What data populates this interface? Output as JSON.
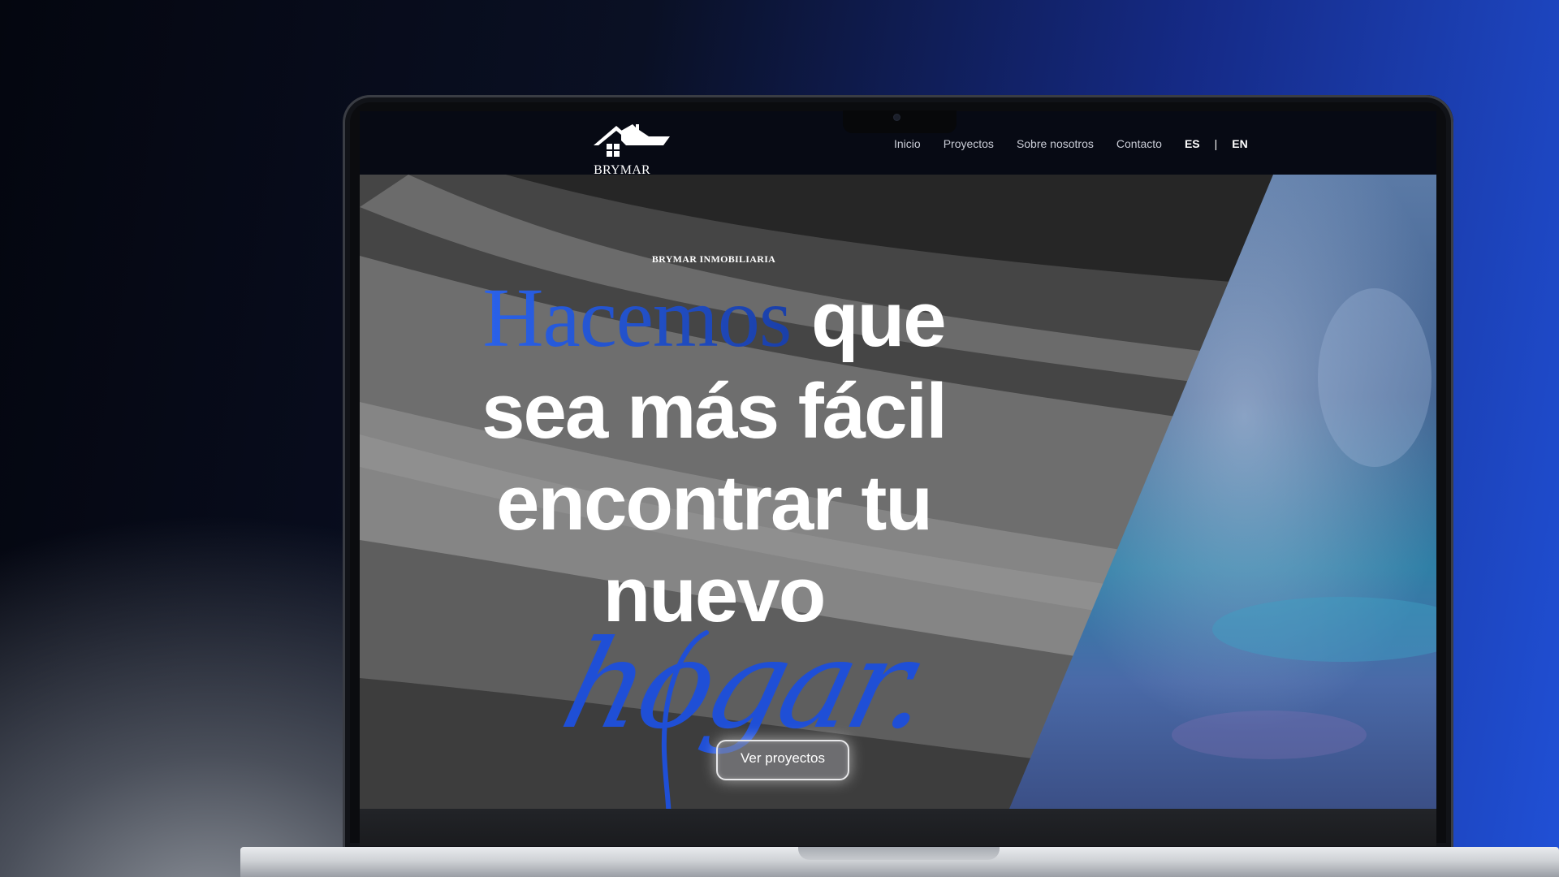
{
  "brand": {
    "name": "BRYMAR INMOBILIARIA"
  },
  "nav": {
    "links": [
      "Inicio",
      "Proyectos",
      "Sobre nosotros",
      "Contacto"
    ],
    "lang_es": "ES",
    "lang_separator": "|",
    "lang_en": "EN"
  },
  "hero": {
    "kicker": "BRYMAR INMOBILIARIA",
    "headline_accent": "Hacemos",
    "headline_line1_rest": "que",
    "headline_line2": "sea más fácil",
    "headline_line3": "encontrar tu",
    "headline_line4": "nuevo",
    "headline_script": "hogar.",
    "cta_label": "Ver proyectos"
  },
  "colors": {
    "accent_blue": "#2a62ea",
    "nav_background": "#070a14"
  }
}
